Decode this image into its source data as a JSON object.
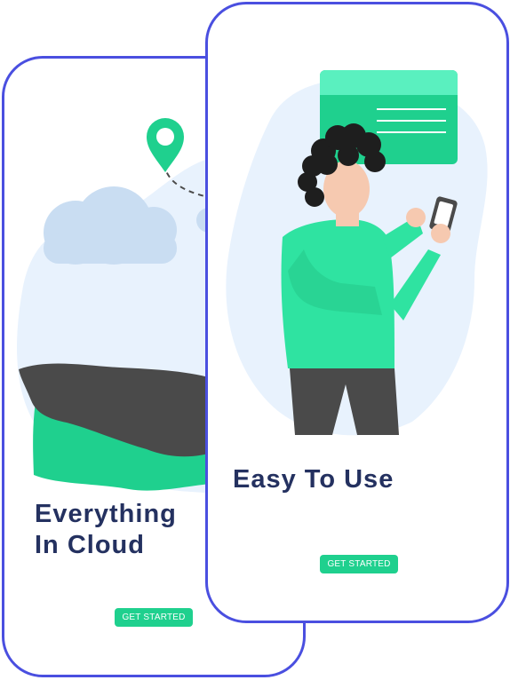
{
  "screens": [
    {
      "title_lines": [
        "Everything",
        "In Cloud"
      ],
      "button_label": "GET STARTED"
    },
    {
      "title": "Easy To Use",
      "button_label": "GET STARTED"
    }
  ],
  "colors": {
    "frame": "#4a4fe0",
    "accent": "#1fd08e",
    "heading": "#243160",
    "blob": "#e8f2fd",
    "cloud": "#c9ddf2",
    "dark": "#4a4a4a",
    "shirt": "#2fe3a1",
    "hair": "#1e1e1e",
    "skin": "#f6c9b0"
  },
  "icons": [
    "location-pin-icon",
    "cloud-icon",
    "smartphone-icon",
    "chat-card-icon"
  ]
}
